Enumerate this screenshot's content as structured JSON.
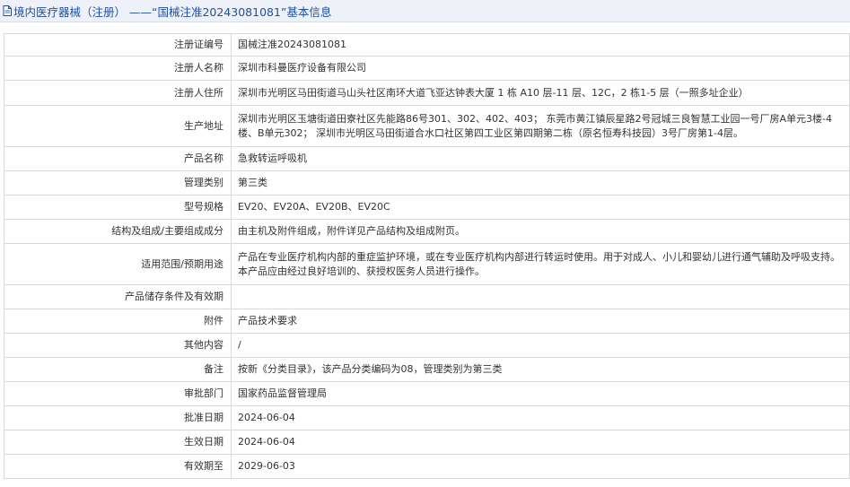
{
  "header": {
    "icon": "document-icon",
    "title": "境内医疗器械（注册） ——“国械注准20243081081”基本信息",
    "title_color": "#1e4fa3"
  },
  "rows": [
    {
      "label": "注册证编号",
      "value": "国械注准20243081081"
    },
    {
      "label": "注册人名称",
      "value": "深圳市科曼医疗设备有限公司"
    },
    {
      "label": "注册人住所",
      "value": "深圳市光明区马田街道马山头社区南环大道飞亚达钟表大厦 1 栋 A10 层-11 层、12C，2 栋1-5 层（一照多址企业）"
    },
    {
      "label": "生产地址",
      "value": "深圳市光明区玉塘街道田寮社区先能路86号301、302、402、403； 东莞市黄江镇辰星路2号冠城三良智慧工业园一号厂房A单元3楼-4楼、B单元302； 深圳市光明区马田街道合水口社区第四工业区第四期第二栋（原名恒寿科技园）3号厂房第1-4层。"
    },
    {
      "label": "产品名称",
      "value": "急救转运呼吸机"
    },
    {
      "label": "管理类别",
      "value": "第三类"
    },
    {
      "label": "型号规格",
      "value": "EV20、EV20A、EV20B、EV20C"
    },
    {
      "label": "结构及组成/主要组成成分",
      "value": "由主机及附件组成，附件详见产品结构及组成附页。"
    },
    {
      "label": "适用范围/预期用途",
      "value": "产品在专业医疗机构内部的重症监护环境，或在专业医疗机构内部进行转运时使用。用于对成人、小儿和婴幼儿进行通气辅助及呼吸支持。本产品应由经过良好培训的、获授权医务人员进行操作。"
    },
    {
      "label": "产品储存条件及有效期",
      "value": ""
    },
    {
      "label": "附件",
      "value": "产品技术要求"
    },
    {
      "label": "其他内容",
      "value": "/"
    },
    {
      "label": "备注",
      "value": "按新《分类目录》，该产品分类编码为08，管理类别为第三类"
    },
    {
      "label": "审批部门",
      "value": "国家药品监督管理局"
    },
    {
      "label": "批准日期",
      "value": "2024-06-04"
    },
    {
      "label": "生效日期",
      "value": "2024-06-04"
    },
    {
      "label": "有效期至",
      "value": "2029-06-03"
    }
  ]
}
